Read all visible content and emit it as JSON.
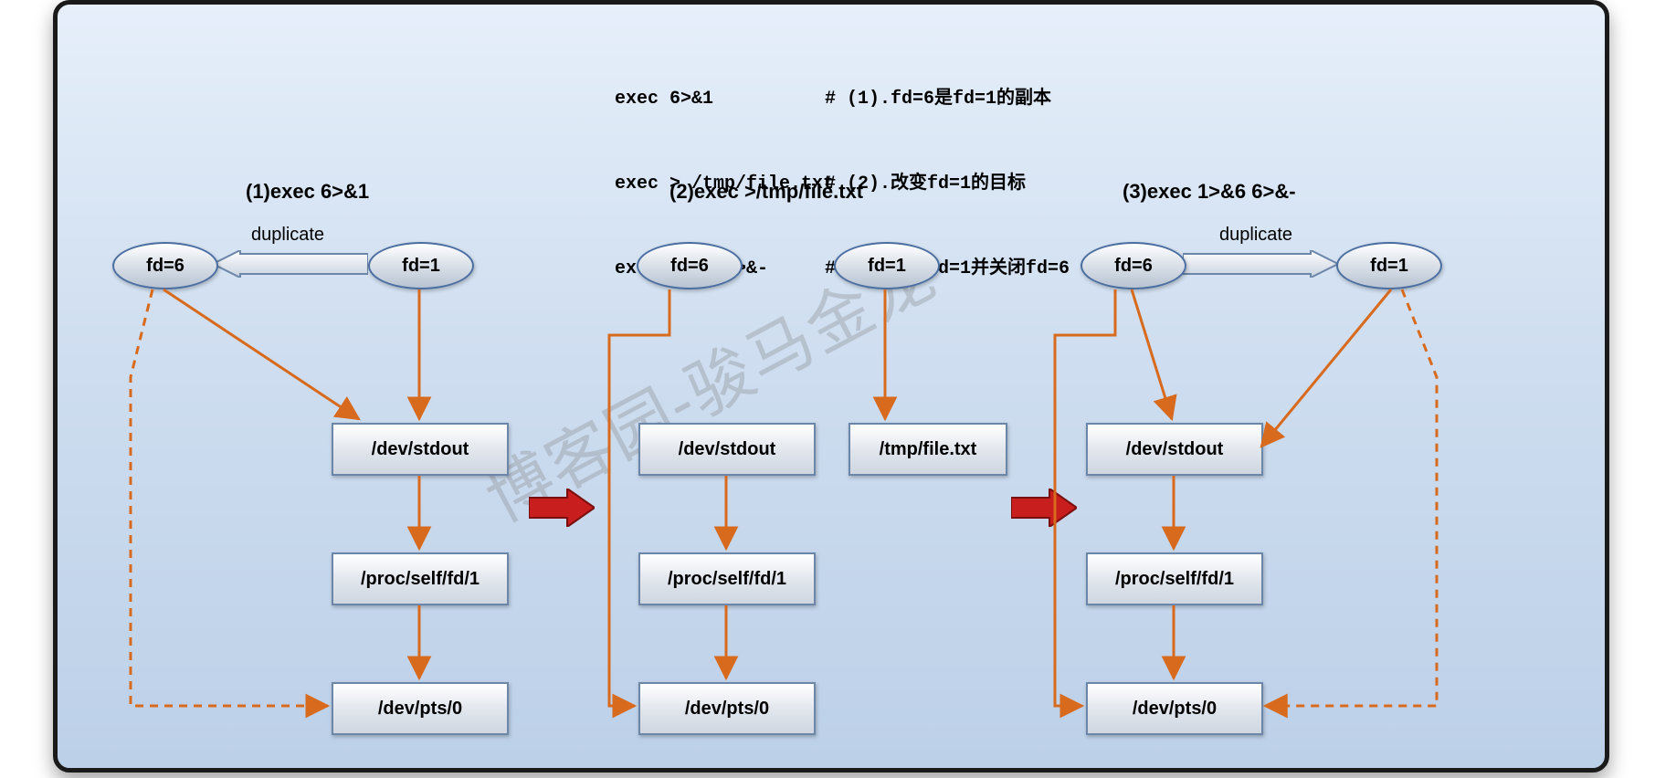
{
  "code": {
    "lines": [
      {
        "cmd": "exec 6>&1",
        "comment": "# (1).fd=6是fd=1的副本"
      },
      {
        "cmd": "exec > /tmp/file.txt",
        "comment": "# (2).改变fd=1的目标"
      },
      {
        "cmd": "exec 1>&6 6>&-",
        "comment": "# (3).恢复fd=1并关闭fd=6"
      }
    ]
  },
  "steps": {
    "s1": {
      "title": "(1)exec 6>&1",
      "dup_label": "duplicate"
    },
    "s2": {
      "title": "(2)exec >/tmp/file.txt"
    },
    "s3": {
      "title": "(3)exec 1>&6 6>&-",
      "dup_label": "duplicate"
    }
  },
  "labels": {
    "fd6": "fd=6",
    "fd1": "fd=1",
    "stdout": "/dev/stdout",
    "procfd1": "/proc/self/fd/1",
    "pts0": "/dev/pts/0",
    "tmpfile": "/tmp/file.txt"
  },
  "watermark": "博客园-骏马金龙",
  "colors": {
    "arrow_red": "#c81e1e",
    "arrow_orange": "#d86a1e",
    "ellipse_stroke": "#4a6ea0",
    "box_stroke": "#6b86a8"
  }
}
